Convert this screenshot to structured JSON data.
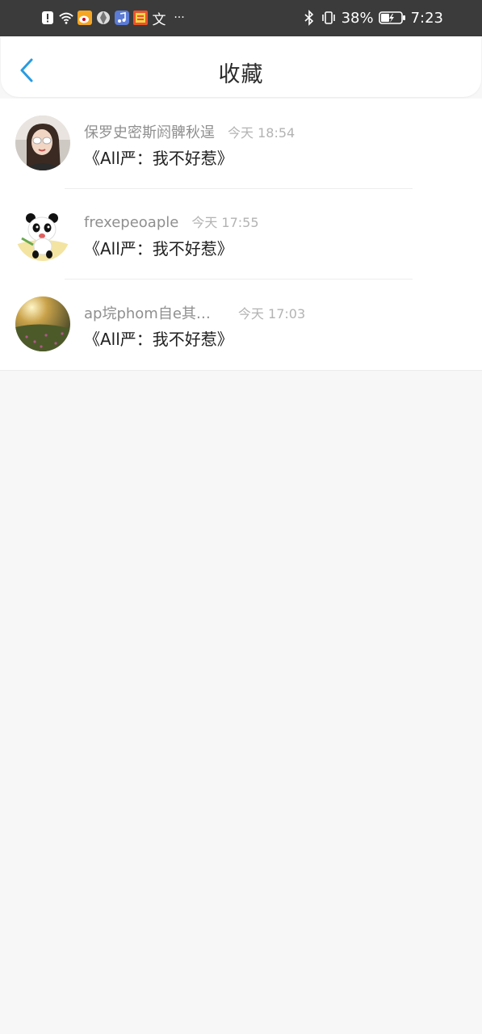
{
  "status_bar": {
    "battery": "38%",
    "time": "7:23",
    "more": "···",
    "translate_glyph": "文"
  },
  "header": {
    "title": "收藏"
  },
  "favorites": [
    {
      "author": "保罗史密斯阏髀秋逞",
      "time": "今天 18:54",
      "title": "《All严：我不好惹》",
      "avatar": "woman-selfie"
    },
    {
      "author": "frexepeoaple",
      "time": "今天 17:55",
      "title": "《All严：我不好惹》",
      "avatar": "panda-cartoon"
    },
    {
      "author": "ap垸phom自e其…",
      "time": "今天 17:03",
      "title": "《All严：我不好惹》",
      "avatar": "sunset-field"
    }
  ],
  "colors": {
    "accent": "#2a9be0",
    "status_bar_bg": "#3b3b3b",
    "page_bg": "#f8f7f7"
  }
}
